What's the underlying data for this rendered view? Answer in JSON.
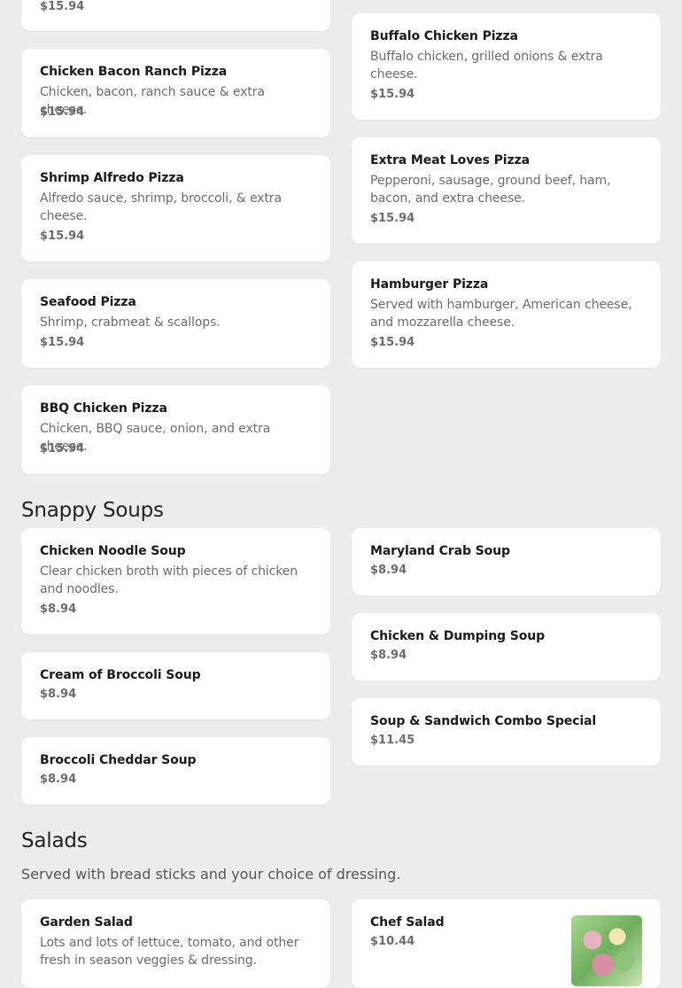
{
  "sections": {
    "soups": {
      "title": "Snappy Soups"
    },
    "salads": {
      "title": "Salads",
      "subtitle": "Served with bread sticks and your choice of dressing."
    }
  },
  "items": {
    "pizza_partial": {
      "price": "$15.94"
    },
    "buffalo": {
      "name": "Buffalo Chicken Pizza",
      "desc": "Buffalo chicken, grilled onions & extra cheese.",
      "price": "$15.94"
    },
    "bacon_ranch": {
      "name": "Chicken Bacon Ranch Pizza",
      "desc": "Chicken, bacon, ranch sauce & extra cheese.",
      "price": "$15.94"
    },
    "extra_meat": {
      "name": "Extra Meat Loves Pizza",
      "desc": "Pepperoni, sausage, ground beef, ham, bacon, and extra cheese.",
      "price": "$15.94"
    },
    "shrimp_alfredo": {
      "name": "Shrimp Alfredo Pizza",
      "desc": "Alfredo sauce, shrimp, broccoli, & extra cheese.",
      "price": "$15.94"
    },
    "hamburger": {
      "name": "Hamburger Pizza",
      "desc": "Served with hamburger, American cheese, and mozzarella cheese.",
      "price": "$15.94"
    },
    "seafood": {
      "name": "Seafood Pizza",
      "desc": "Shrimp, crabmeat & scallops.",
      "price": "$15.94"
    },
    "bbq_chicken": {
      "name": "BBQ Chicken Pizza",
      "desc": "Chicken, BBQ sauce, onion, and extra cheese.",
      "price": "$15.94"
    },
    "chicken_noodle": {
      "name": "Chicken Noodle Soup",
      "desc": "Clear chicken broth with pieces of chicken and noodles.",
      "price": "$8.94"
    },
    "maryland_crab": {
      "name": "Maryland Crab Soup",
      "price": "$8.94"
    },
    "chicken_dumping": {
      "name": "Chicken & Dumping Soup",
      "price": "$8.94"
    },
    "cream_broccoli": {
      "name": "Cream of Broccoli Soup",
      "price": "$8.94"
    },
    "combo": {
      "name": "Soup & Sandwich Combo Special",
      "price": "$11.45"
    },
    "broccoli_cheddar": {
      "name": "Broccoli Cheddar Soup",
      "price": "$8.94"
    },
    "garden_salad": {
      "name": "Garden Salad",
      "desc": "Lots and lots of lettuce, tomato, and other fresh in season veggies & dressing."
    },
    "chef_salad": {
      "name": "Chef Salad",
      "price": "$10.44",
      "image": "salad-photo"
    }
  }
}
